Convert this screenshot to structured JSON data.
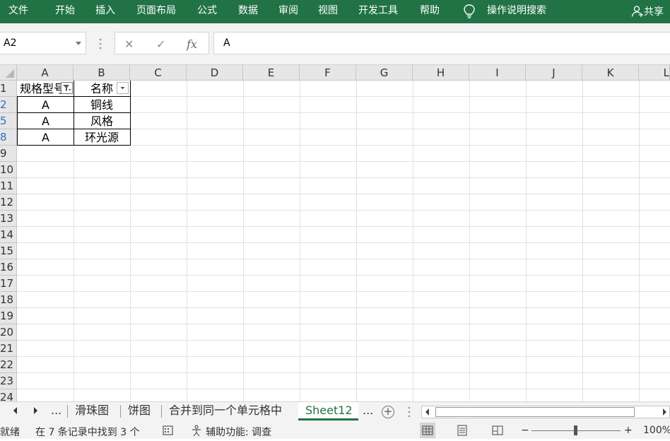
{
  "ribbon": {
    "tabs": [
      "文件",
      "开始",
      "插入",
      "页面布局",
      "公式",
      "数据",
      "审阅",
      "视图",
      "开发工具",
      "帮助"
    ],
    "search_label": "操作说明搜索",
    "share_label": "共享"
  },
  "formula_bar": {
    "name_box": "A2",
    "cancel_symbol": "✕",
    "enter_symbol": "✓",
    "fx_symbol": "fx",
    "content": "A"
  },
  "columns": [
    "A",
    "B",
    "C",
    "D",
    "E",
    "F",
    "G",
    "H",
    "I",
    "J",
    "K",
    "L"
  ],
  "rows": [
    "1",
    "2",
    "5",
    "8",
    "9",
    "10",
    "11",
    "12",
    "13",
    "14",
    "15",
    "16",
    "17",
    "18",
    "19",
    "20",
    "21",
    "22",
    "23",
    "24"
  ],
  "table": {
    "headers": [
      "规格型号",
      "名称"
    ],
    "rows": [
      [
        "A",
        "铜线"
      ],
      [
        "A",
        "风格"
      ],
      [
        "A",
        "环光源"
      ]
    ]
  },
  "sheet_tabs": {
    "left_ellipsis": "...",
    "tabs": [
      "滑珠图",
      "饼图",
      "合并到同一个单元格中",
      "Sheet12"
    ],
    "active": "Sheet12",
    "right_ellipsis": "..."
  },
  "status_bar": {
    "mode": "就绪",
    "filter_info": "在 7 条记录中找到 3 个",
    "accessibility": "辅助功能: 调查",
    "zoom_minus": "−",
    "zoom_plus": "+",
    "zoom": "100%"
  },
  "colors": {
    "ribbon": "#217346",
    "active_tab_text": "#217346",
    "filtered_row_number": "#2f6fc0"
  }
}
